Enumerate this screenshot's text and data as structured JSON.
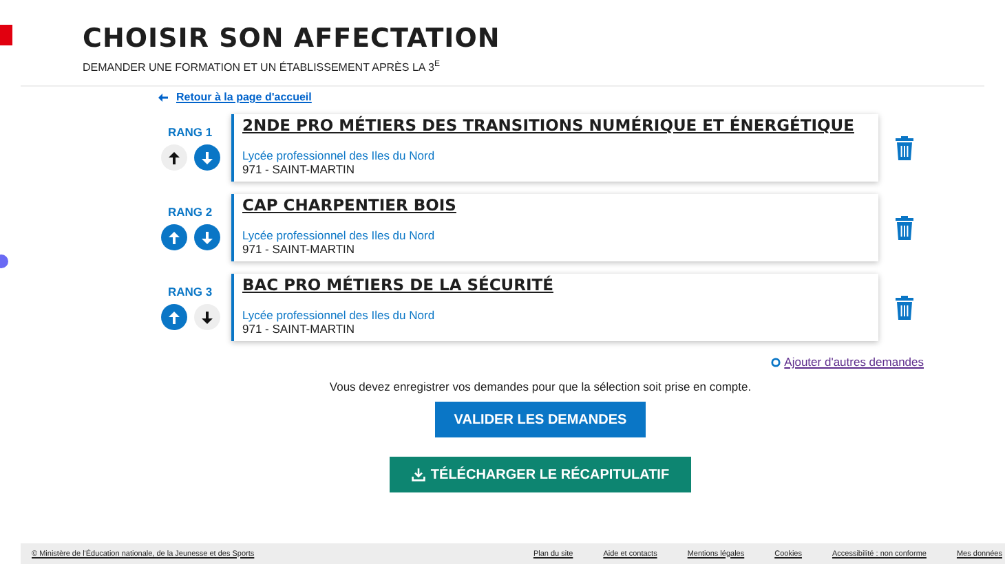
{
  "header": {
    "title": "CHOISIR SON AFFECTATION",
    "subtitle": "DEMANDER UNE FORMATION ET UN ÉTABLISSEMENT APRÈS LA 3$^{E}$"
  },
  "back_link": "Retour à la page d'accueil",
  "choices": [
    {
      "rank": "RANG 1",
      "title": "2NDE PRO MÉTIERS DES TRANSITIONS NUMÉRIQUE ET ÉNERGÉTIQUE",
      "school": "Lycée professionnel des Iles du Nord",
      "location": "971 - SAINT-MARTIN",
      "up_disabled": true,
      "down_disabled": false
    },
    {
      "rank": "RANG 2",
      "title": "CAP CHARPENTIER BOIS",
      "school": "Lycée professionnel des Iles du Nord",
      "location": "971 - SAINT-MARTIN",
      "up_disabled": false,
      "down_disabled": false
    },
    {
      "rank": "RANG 3",
      "title": "BAC PRO MÉTIERS DE LA SÉCURITÉ",
      "school": "Lycée professionnel des Iles du Nord",
      "location": "971 - SAINT-MARTIN",
      "up_disabled": false,
      "down_disabled": true
    }
  ],
  "add_link": "Ajouter d'autres demandes",
  "notice": "Vous devez enregistrer vos demandes pour que la sélection soit prise en compte.",
  "buttons": [
    {
      "kind": "primary",
      "label": "VALIDER LES DEMANDES"
    },
    {
      "kind": "download",
      "label": "TÉLÉCHARGER LE RÉCAPITULATIF"
    }
  ],
  "footer": {
    "copyright": "© Ministère de l'Éducation nationale, de la Jeunesse et des Sports",
    "links": [
      "Plan du site",
      "Aide et contacts",
      "Mentions légales",
      "Cookies",
      "Accessibilité : non conforme",
      "Mes données"
    ]
  }
}
